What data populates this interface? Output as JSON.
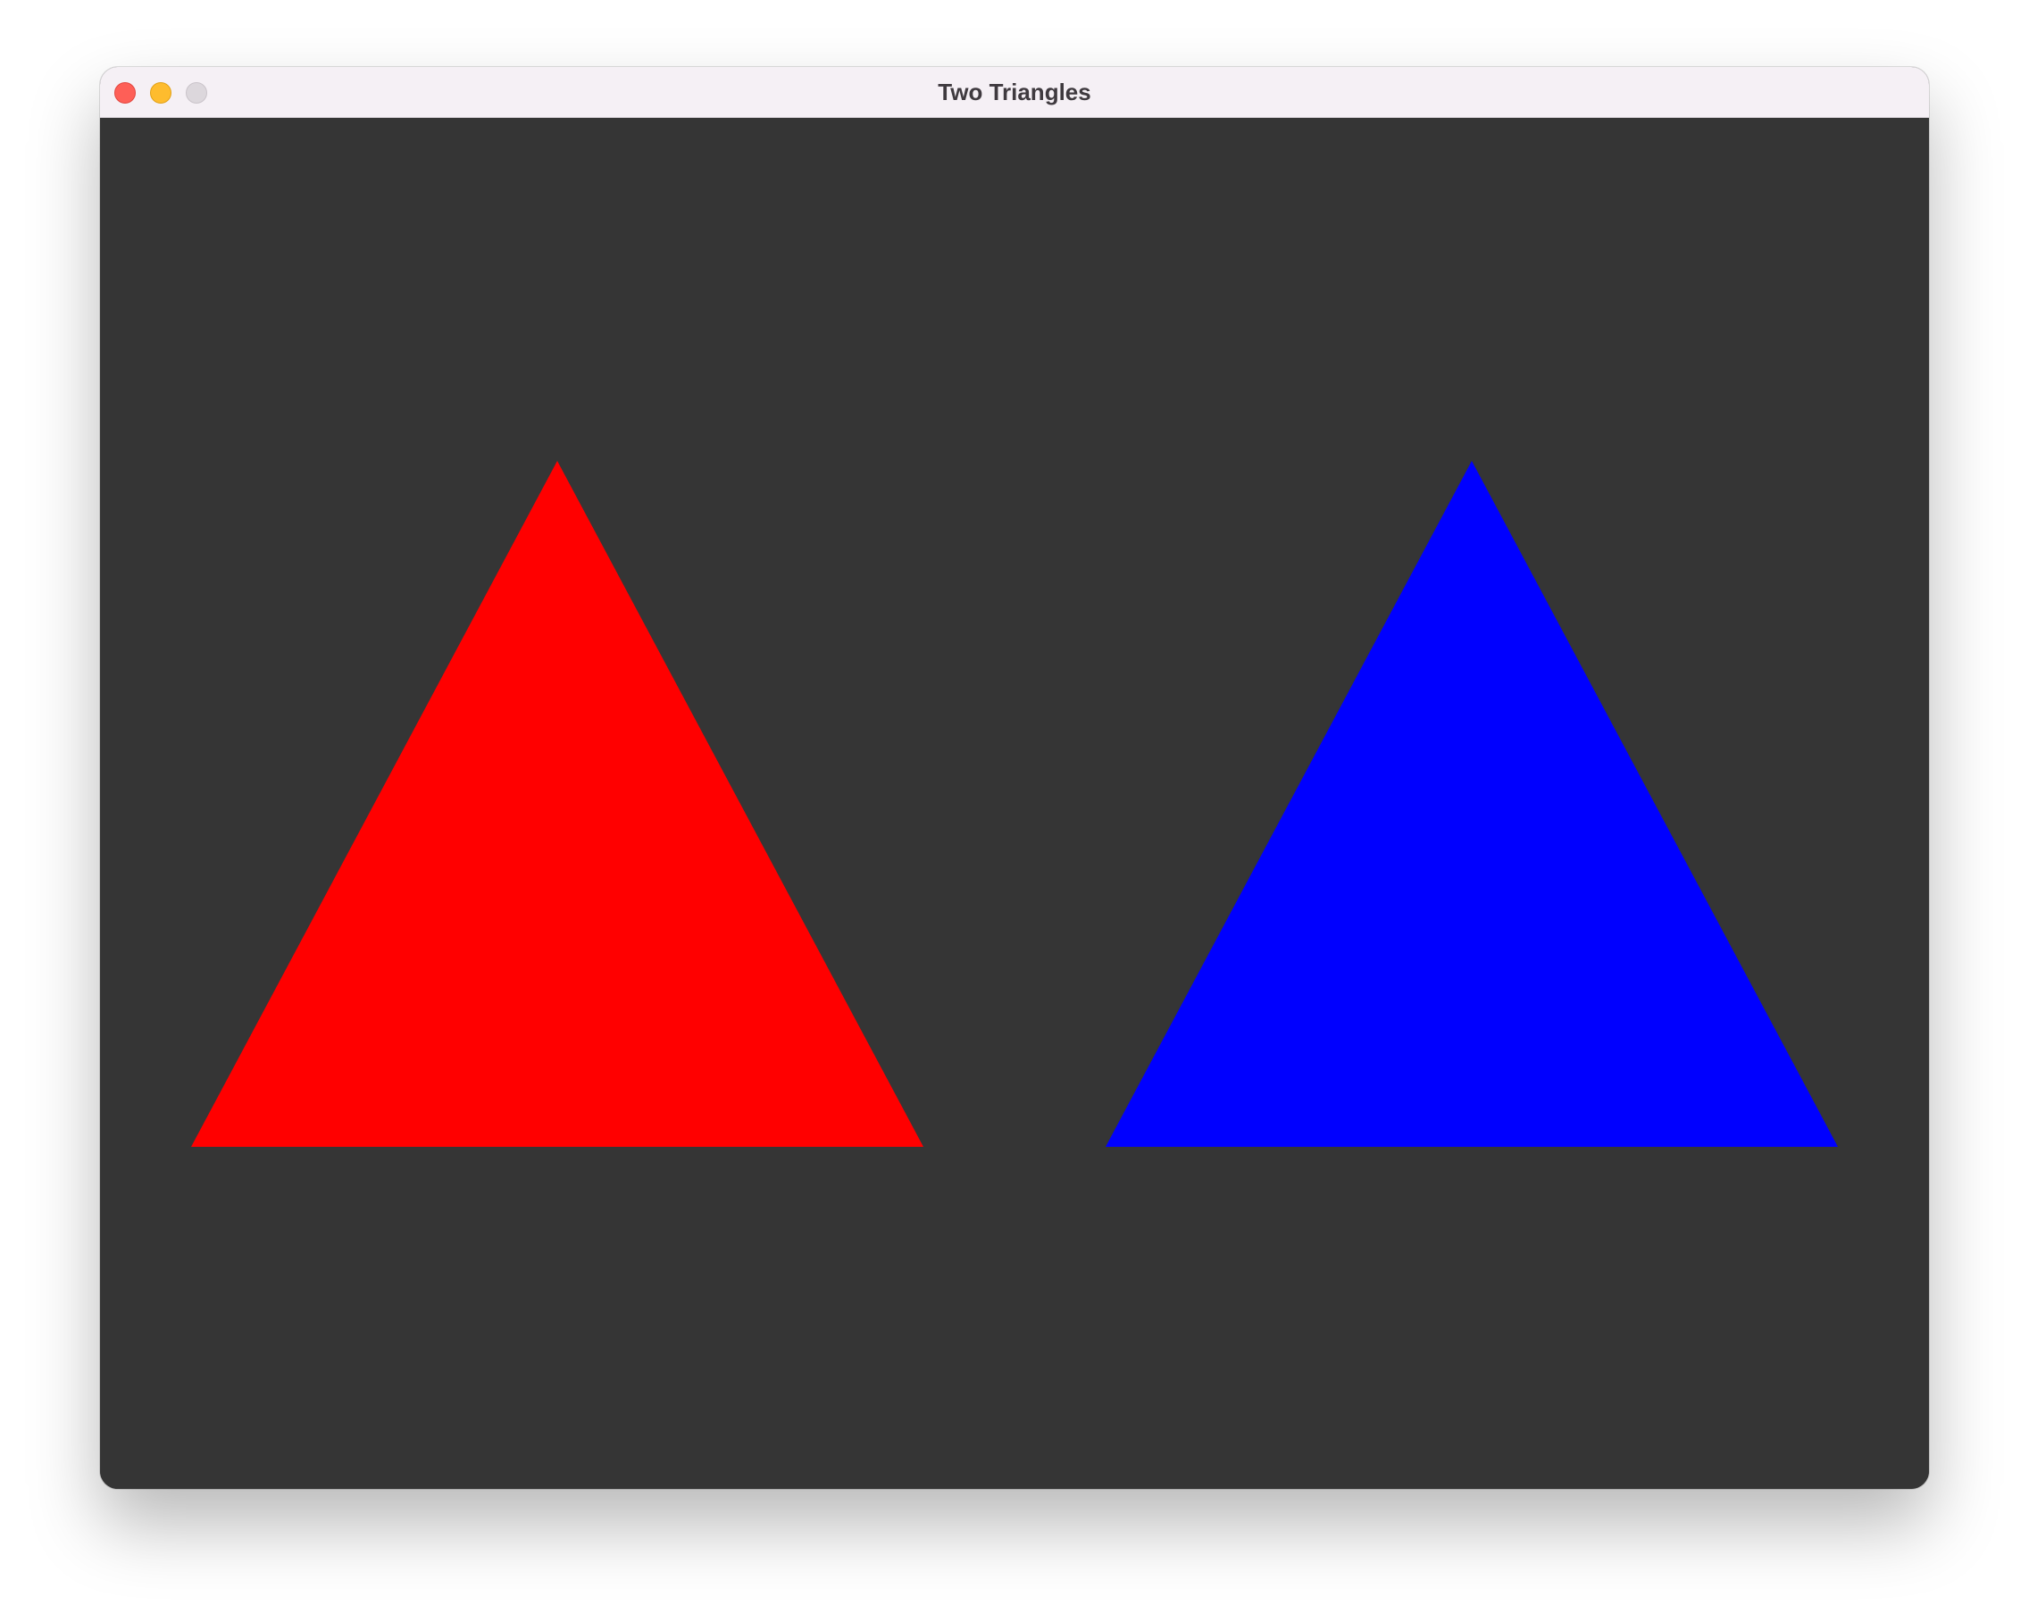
{
  "window": {
    "title": "Two Triangles",
    "controls": {
      "close_color": "#fe5f57",
      "minimize_color": "#febc2e",
      "zoom_color": "#dcd7dc"
    }
  },
  "canvas": {
    "background_color": "#353535",
    "shapes": [
      {
        "name": "red-triangle",
        "type": "triangle",
        "color": "#ff0000"
      },
      {
        "name": "blue-triangle",
        "type": "triangle",
        "color": "#0000ff"
      }
    ]
  }
}
